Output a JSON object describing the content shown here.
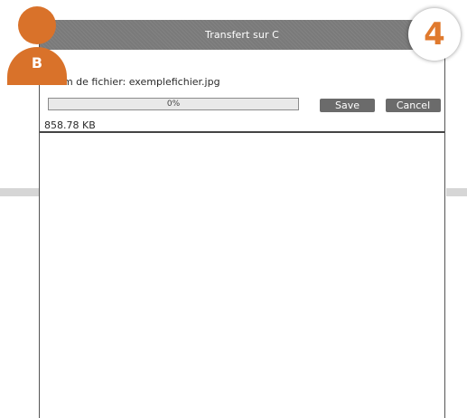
{
  "dialog": {
    "title": "Transfert sur C",
    "filename_text": "Nom de fichier: exemplefichier.jpg",
    "progress": {
      "percent_label": "0%",
      "value": 0
    },
    "buttons": {
      "save_label": "Save",
      "cancel_label": "Cancel"
    },
    "filesize_text": "858.78 KB"
  },
  "annotations": {
    "user_badge_letter": "B",
    "step_number": "4"
  },
  "colors": {
    "accent_orange": "#d9722a",
    "titlebar": "#7a7a7a",
    "button": "#6b6b6b"
  }
}
